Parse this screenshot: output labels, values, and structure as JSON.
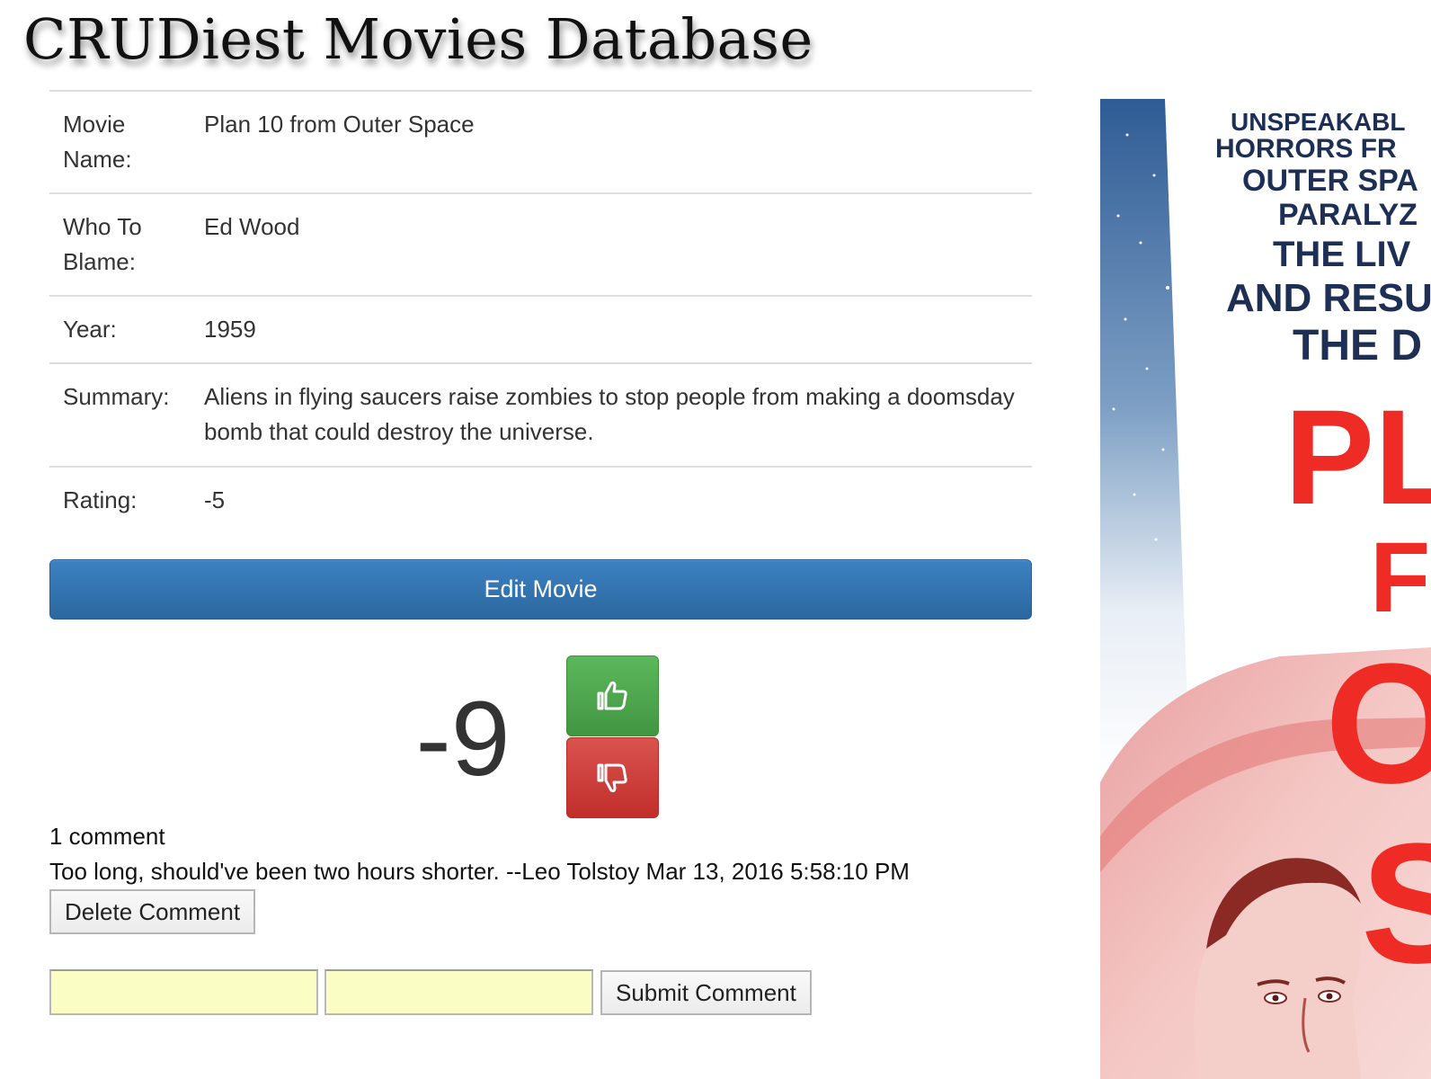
{
  "app": {
    "title": "CRUDiest Movies Database"
  },
  "movie": {
    "rows": [
      {
        "label": "Movie Name:",
        "value": "Plan 10 from Outer Space"
      },
      {
        "label": "Who To Blame:",
        "value": "Ed Wood"
      },
      {
        "label": "Year:",
        "value": "1959"
      },
      {
        "label": "Summary:",
        "value": "Aliens in flying saucers raise zombies to stop people from making a doomsday bomb that could destroy the universe."
      },
      {
        "label": "Rating:",
        "value": "-5"
      }
    ]
  },
  "actions": {
    "edit_label": "Edit Movie"
  },
  "votes": {
    "score": "-9",
    "up_icon": "thumbs-up-icon",
    "down_icon": "thumbs-down-icon",
    "up_color": "#5cb85c",
    "down_color": "#d9534f"
  },
  "comments": {
    "count_text": "1 comment",
    "items": [
      {
        "text": "Too long, should've been two hours shorter. --Leo Tolstoy Mar 13, 2016 5:58:10 PM",
        "delete_label": "Delete Comment"
      }
    ]
  },
  "comment_form": {
    "field1_value": "",
    "field2_value": "",
    "submit_label": "Submit Comment"
  },
  "poster": {
    "tagline_lines": [
      "UNSPEAKABL",
      "HORRORS FR",
      "OUTER SPA",
      "PARALYZ",
      "THE LIV",
      "AND RESU",
      "THE D"
    ],
    "title_fragments": [
      "PLA",
      "FR",
      "O",
      "S"
    ]
  },
  "colors": {
    "primary": "#337ab7",
    "input_background": "#fafdc4"
  }
}
